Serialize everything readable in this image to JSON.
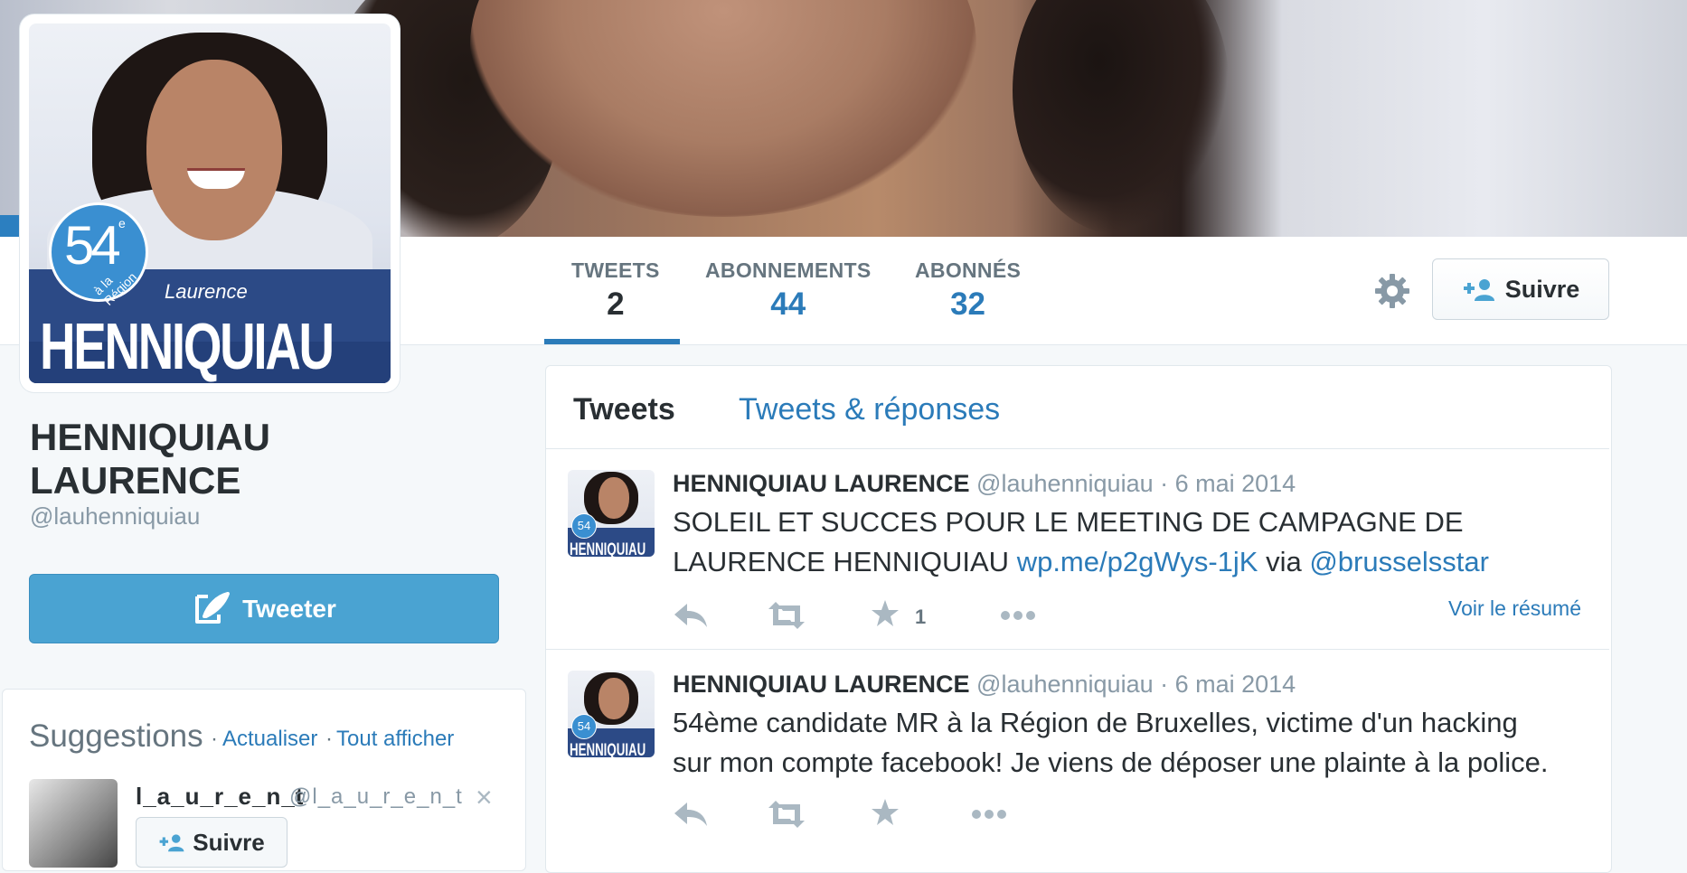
{
  "profile": {
    "avatar": {
      "number": "54",
      "superscript": "e",
      "region_text": "à la Région",
      "first_name": "Laurence",
      "last_name": "HENNIQUIAU"
    },
    "name_line1": "HENNIQUIAU",
    "name_line2": "LAURENCE",
    "handle": "@lauhenniquiau"
  },
  "nav": {
    "stats": [
      {
        "label": "TWEETS",
        "value": "2"
      },
      {
        "label": "ABONNEMENTS",
        "value": "44"
      },
      {
        "label": "ABONNÉS",
        "value": "32"
      }
    ],
    "follow_label": "Suivre",
    "gear_icon": "gear-icon"
  },
  "left": {
    "tweet_button_label": "Tweeter",
    "suggestions": {
      "title": "Suggestions",
      "separator": "·",
      "refresh_label": "Actualiser",
      "view_all_label": "Tout afficher",
      "user": {
        "name": "l_a_u_r_e_n_t",
        "handle": "@l_a_u_r_e_n_t",
        "close": "×",
        "follow_label": "Suivre"
      }
    }
  },
  "timeline": {
    "tabs": [
      "Tweets",
      "Tweets & réponses"
    ],
    "tweets": [
      {
        "name": "HENNIQUIAU LAURENCE",
        "meta": "@lauhenniquiau · 6 mai 2014",
        "text_line1": "SOLEIL ET SUCCES POUR LE MEETING DE CAMPAGNE DE",
        "text_line2_pre": "LAURENCE HENNIQUIAU ",
        "link": "wp.me/p2gWys-1jK",
        "via": " via ",
        "mention": "@brusselsstar",
        "favorites": "1",
        "summary_label": "Voir le résumé"
      },
      {
        "name": "HENNIQUIAU LAURENCE",
        "meta": "@lauhenniquiau · 6 mai 2014",
        "text_line1": "54ème candidate MR à la Région de Bruxelles, victime d'un hacking",
        "text_line2": "sur mon compte facebook! Je viens de déposer une plainte à la police."
      }
    ]
  },
  "colors": {
    "accent": "#2b7bb9",
    "tweet_button": "#4aa3d2",
    "avatar_band": "#2c4a86"
  }
}
